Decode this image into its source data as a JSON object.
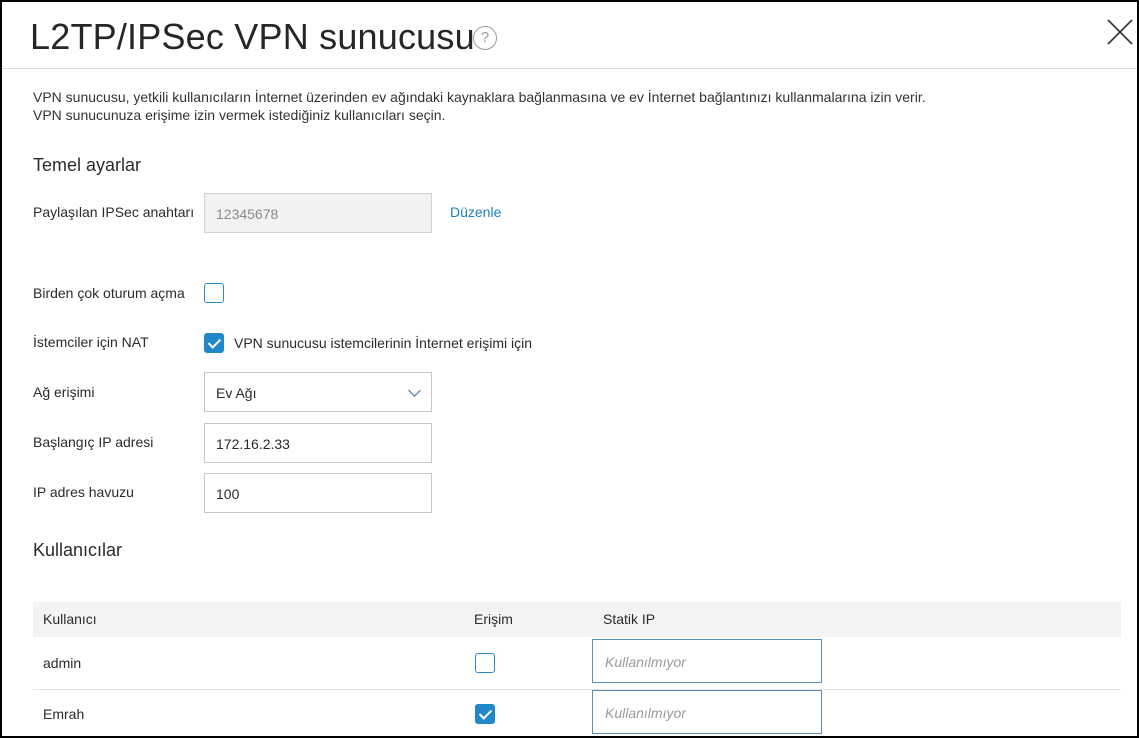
{
  "dialog": {
    "title": "L2TP/IPSec VPN sunucusu",
    "help_glyph": "?",
    "description": [
      "VPN sunucusu, yetkili kullanıcıların İnternet üzerinden ev ağındaki kaynaklara bağlanmasına ve ev İnternet bağlantınızı kullanmalarına izin verir.",
      "VPN sunucunuza erişime izin vermek istediğiniz kullanıcıları seçin."
    ]
  },
  "basic": {
    "heading": "Temel ayarlar",
    "psk_label": "Paylaşılan IPSec anahtarı",
    "psk_value": "12345678",
    "edit_link": "Düzenle",
    "multi_session_label": "Birden çok oturum açma",
    "multi_session_checked": false,
    "nat_label": "İstemciler için NAT",
    "nat_checked": true,
    "nat_text": "VPN sunucusu istemcilerinin İnternet erişimi için",
    "network_label": "Ağ erişimi",
    "network_value": "Ev Ağı",
    "start_ip_label": "Başlangıç IP adresi",
    "start_ip_value": "172.16.2.33",
    "pool_label": "IP adres havuzu",
    "pool_value": "100"
  },
  "users": {
    "heading": "Kullanıcılar",
    "columns": [
      "Kullanıcı",
      "Erişim",
      "Statik IP"
    ],
    "rows": [
      {
        "name": "admin",
        "access": false,
        "static_ip_placeholder": "Kullanılmıyor"
      },
      {
        "name": "Emrah",
        "access": true,
        "static_ip_placeholder": "Kullanılmıyor"
      }
    ]
  },
  "colors": {
    "accent": "#1e88c8",
    "link": "#1a7fbf"
  }
}
